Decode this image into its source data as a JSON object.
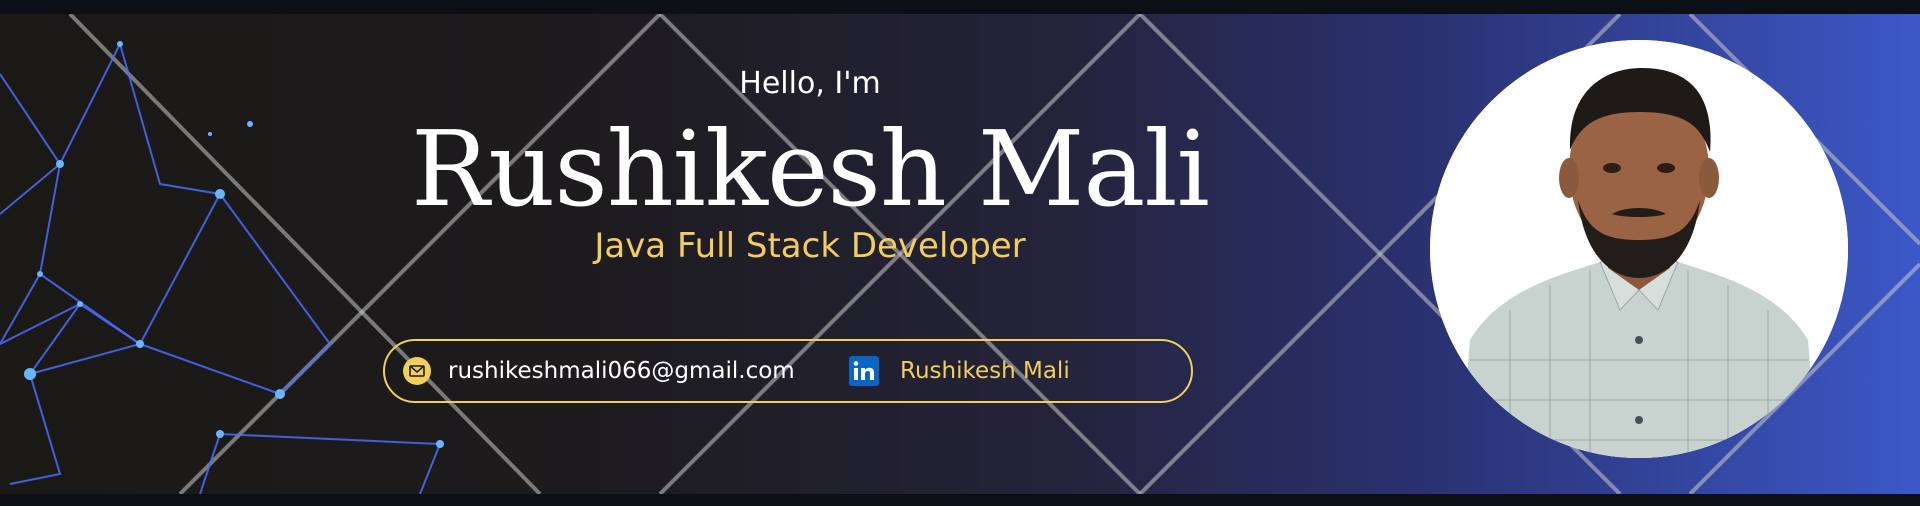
{
  "profile": {
    "greeting": "Hello, I'm",
    "name": "Rushikesh Mali",
    "title": "Java Full Stack Developer"
  },
  "contact": {
    "email": "rushikeshmali066@gmail.com",
    "linkedin": "Rushikesh Mali"
  },
  "icons": {
    "email": "email-icon",
    "linkedin": "linkedin-icon"
  },
  "colors": {
    "accent": "#f4cd5d",
    "linkedin": "#0a66c2",
    "text": "#ffffff"
  }
}
